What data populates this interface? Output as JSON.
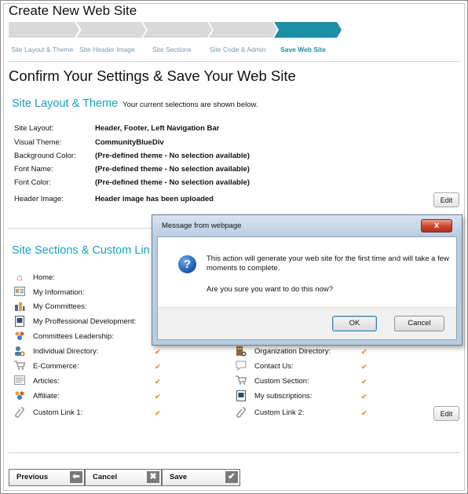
{
  "page": {
    "title": "Create New Web Site"
  },
  "wizard": {
    "steps": [
      {
        "label": "Site Layout & Theme"
      },
      {
        "label": "Site Header Image"
      },
      {
        "label": "Site Sections"
      },
      {
        "label": "Site Code & Admin"
      },
      {
        "label": "Save Web Site"
      }
    ],
    "active_step": "Save Web Site",
    "inactive_color": "#d9d9d9",
    "active_color": "#1a8fa6"
  },
  "heading": "Confirm Your Settings & Save Your Web Site",
  "layout_section": {
    "title": "Site Layout & Theme",
    "note": "Your current selections are shown below.",
    "rows": [
      {
        "label": "Site Layout:",
        "value": "Header, Footer, Left Navigation Bar"
      },
      {
        "label": "Visual Theme:",
        "value": "CommunityBlueDiv"
      },
      {
        "label": "Background Color:",
        "value": "(Pre-defined theme - No selection available)"
      },
      {
        "label": "Font Name:",
        "value": "(Pre-defined theme - No selection available)"
      },
      {
        "label": "Font Color:",
        "value": "(Pre-defined theme - No selection available)"
      },
      {
        "label": "Header Image:",
        "value": "Header image has been uploaded"
      }
    ],
    "edit_label": "Edit"
  },
  "sections_section": {
    "title": "Site Sections & Custom Lin",
    "left_items": [
      {
        "label": "Home:",
        "icon": "home-icon"
      },
      {
        "label": "My Information:",
        "icon": "id-card-icon"
      },
      {
        "label": "My Committees:",
        "icon": "org-chart-icon"
      },
      {
        "label": "My Proffessional Development:",
        "icon": "document-icon"
      },
      {
        "label": "Committees Leadership:",
        "icon": "group-icon"
      },
      {
        "label": "Individual Directory:",
        "icon": "person-search-icon"
      },
      {
        "label": "E-Commerce:",
        "icon": "cart-icon"
      },
      {
        "label": "Articles:",
        "icon": "articles-icon"
      },
      {
        "label": "Affiliate:",
        "icon": "group-icon"
      },
      {
        "label": "Custom Link 1:",
        "icon": "link-icon"
      }
    ],
    "right_items": [
      {
        "label": "Organization Directory:",
        "icon": "building-search-icon"
      },
      {
        "label": "Contact Us:",
        "icon": "speech-bubble-icon"
      },
      {
        "label": "Custom Section:",
        "icon": "cart-icon"
      },
      {
        "label": "My subscriptions:",
        "icon": "document-icon"
      },
      {
        "label": "Custom Link 2:",
        "icon": "link-icon"
      }
    ],
    "check_glyph": "✔",
    "edit_label": "Edit"
  },
  "footer": {
    "previous_label": "Previous",
    "cancel_label": "Cancel",
    "save_label": "Save"
  },
  "dialog": {
    "title": "Message from webpage",
    "close_glyph": "x",
    "message": "This action will generate your web site for the first time and will take a few moments to complete.",
    "question": "Are you sure you want to do this now?",
    "ok_label": "OK",
    "cancel_label": "Cancel",
    "icon": "question-icon"
  }
}
